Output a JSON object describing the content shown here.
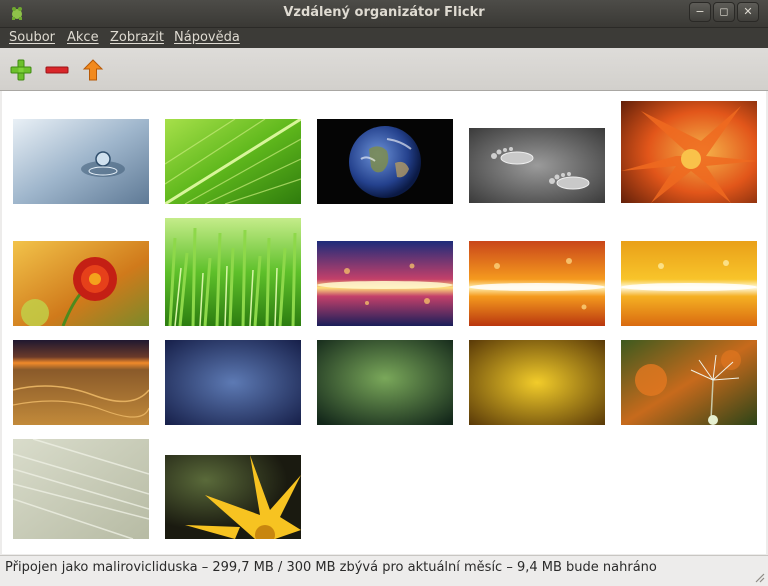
{
  "window": {
    "title": "Vzdálený organizátor Flickr"
  },
  "window_buttons": {
    "minimize": "−",
    "maximize": "◻",
    "close": "✕"
  },
  "menu": {
    "items": [
      {
        "label": "Soubor"
      },
      {
        "label": "Akce"
      },
      {
        "label": "Zobrazit"
      },
      {
        "label": "Nápověda"
      }
    ]
  },
  "toolbar": {
    "add_icon": "plus-icon",
    "remove_icon": "minus-icon",
    "upload_icon": "arrow-up-icon",
    "colors": {
      "add": "#6cc02c",
      "remove": "#d9262a",
      "upload": "#f28a1e"
    }
  },
  "photos": [
    {
      "name": "water-drop"
    },
    {
      "name": "green-leaf"
    },
    {
      "name": "earth"
    },
    {
      "name": "water-footprints"
    },
    {
      "name": "orange-flower"
    },
    {
      "name": "marigold"
    },
    {
      "name": "grass"
    },
    {
      "name": "light-streak-blue"
    },
    {
      "name": "light-streak-orange"
    },
    {
      "name": "light-streak-yellow"
    },
    {
      "name": "desert-sunset"
    },
    {
      "name": "blue-texture"
    },
    {
      "name": "green-texture"
    },
    {
      "name": "gold-texture"
    },
    {
      "name": "dandelion-seed"
    },
    {
      "name": "wood-grain"
    },
    {
      "name": "yellow-flower"
    }
  ],
  "status": {
    "text": "Připojen jako malirovicliduska – 299,7 MB / 300 MB zbývá pro aktuální měsíc – 9,4 MB bude nahráno"
  }
}
